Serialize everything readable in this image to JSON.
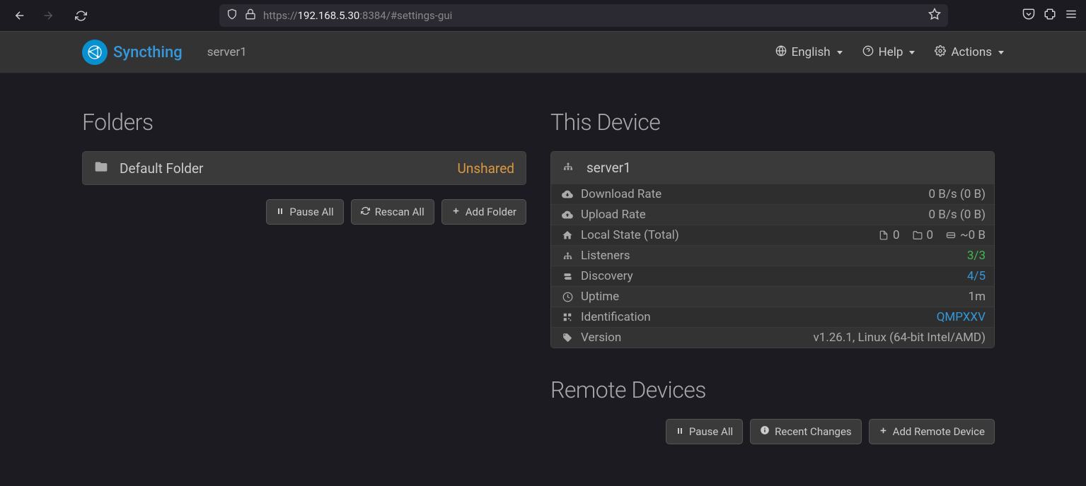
{
  "browser": {
    "url_prefix": "https://",
    "url_host": "192.168.5.30",
    "url_port_path": ":8384/#settings-gui"
  },
  "navbar": {
    "brand": "Syncthing",
    "device": "server1",
    "english": "English",
    "help": "Help",
    "actions": "Actions"
  },
  "folders": {
    "heading": "Folders",
    "default_name": "Default Folder",
    "default_status": "Unshared",
    "pause_all": "Pause All",
    "rescan_all": "Rescan All",
    "add_folder": "Add Folder"
  },
  "this_device": {
    "heading": "This Device",
    "name": "server1",
    "download_rate_label": "Download Rate",
    "download_rate_value": "0 B/s (0 B)",
    "upload_rate_label": "Upload Rate",
    "upload_rate_value": "0 B/s (0 B)",
    "local_state_label": "Local State (Total)",
    "ls_files": "0",
    "ls_dirs": "0",
    "ls_size": "~0 B",
    "listeners_label": "Listeners",
    "listeners_value": "3/3",
    "discovery_label": "Discovery",
    "discovery_value": "4/5",
    "uptime_label": "Uptime",
    "uptime_value": "1m",
    "identification_label": "Identification",
    "identification_value": "QMPXXV",
    "version_label": "Version",
    "version_value": "v1.26.1, Linux (64-bit Intel/AMD)"
  },
  "remote_devices": {
    "heading": "Remote Devices",
    "pause_all": "Pause All",
    "recent_changes": "Recent Changes",
    "add_remote": "Add Remote Device"
  }
}
